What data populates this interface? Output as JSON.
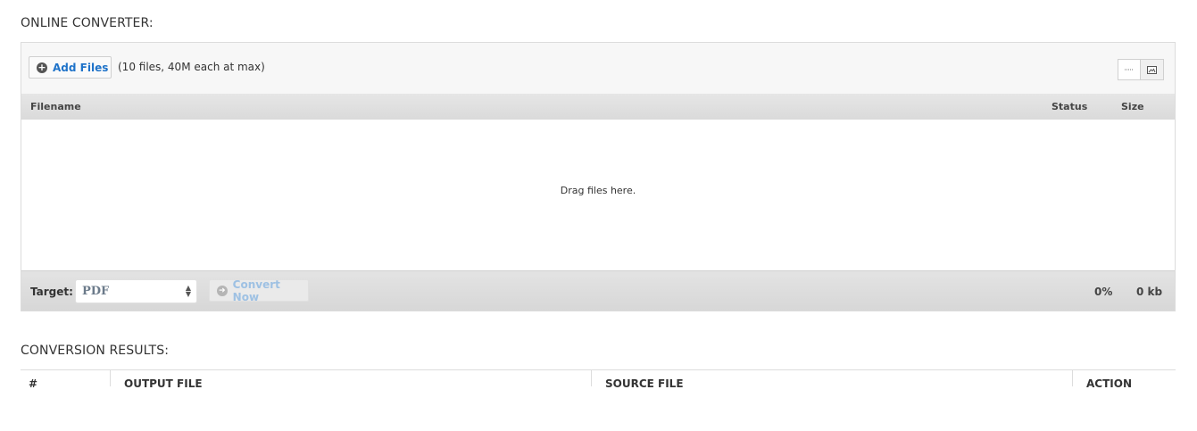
{
  "converter": {
    "title": "ONLINE CONVERTER:",
    "add_files_label": "Add Files",
    "add_icon": "plus-circle-icon",
    "limit_note": "(10 files, 40M each at max)",
    "view_modes": [
      "list-view-icon",
      "thumbnail-view-icon"
    ],
    "columns": {
      "filename": "Filename",
      "status": "Status",
      "size": "Size"
    },
    "drop_text": "Drag files here.",
    "target_label": "Target:",
    "target_value": "PDF",
    "convert_label": "Convert Now",
    "convert_icon": "arrow-circle-icon",
    "progress": "0%",
    "total_size": "0 kb",
    "accent_color": "#1f73c9"
  },
  "results": {
    "title": "CONVERSION RESULTS:",
    "columns": [
      "#",
      "OUTPUT FILE",
      "SOURCE FILE",
      "ACTION"
    ]
  }
}
